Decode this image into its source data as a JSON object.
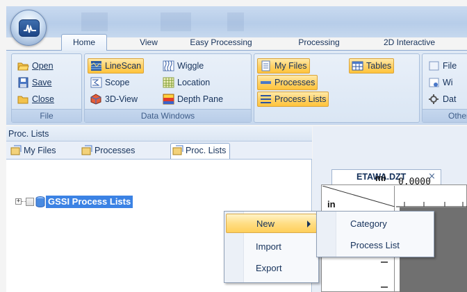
{
  "ribbon": {
    "tabs": [
      "Home",
      "View",
      "Easy Processing",
      "Processing",
      "2D Interactive"
    ],
    "active_tab": "Home",
    "groups": {
      "file": {
        "label": "File",
        "open": "Open",
        "save": "Save",
        "close": "Close"
      },
      "data_windows": {
        "label": "Data Windows",
        "linescan": "LineScan",
        "wiggle": "Wiggle",
        "scope": "Scope",
        "location": "Location",
        "view3d": "3D-View",
        "depth_pane": "Depth Pane"
      },
      "panes": {
        "my_files": "My Files",
        "processes": "Processes",
        "process_lists": "Process Lists",
        "tables": "Tables"
      },
      "other": {
        "label": "Other",
        "file": "File",
        "wi": "Wi",
        "dat": "Dat"
      }
    }
  },
  "left_panel": {
    "title": "Proc. Lists",
    "tabs": [
      "My Files",
      "Processes",
      "Proc. Lists"
    ],
    "active_tab": "Proc. Lists",
    "tree": {
      "expander": "+",
      "label": "GSSI Process Lists"
    }
  },
  "context_menu": {
    "items": [
      "New",
      "Import",
      "Export"
    ],
    "highlighted": "New",
    "submenu": [
      "Category",
      "Process List"
    ]
  },
  "document": {
    "tab_title": "ETAWA.DZT",
    "close_glyph": "×",
    "unit_distance": "mi",
    "unit_depth": "in",
    "start_value": "0.0000"
  },
  "colors": {
    "highlight_orange": "#ffd26a",
    "selection_blue": "#3b82e4",
    "ribbon_blue": "#dfe9f5"
  }
}
